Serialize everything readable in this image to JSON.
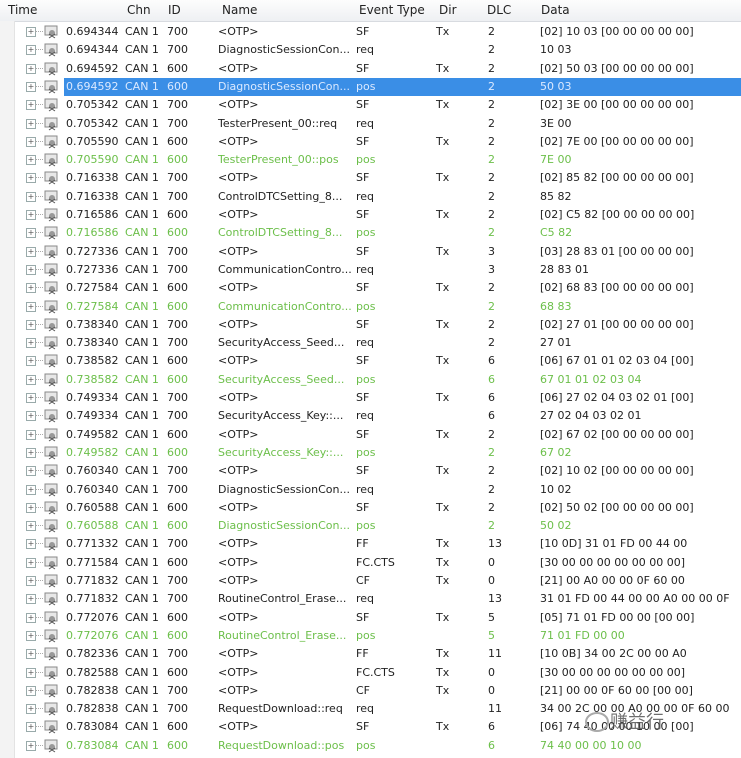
{
  "columns": {
    "time": "Time",
    "chn": "Chn",
    "id": "ID",
    "name": "Name",
    "event_type": "Event Type",
    "dir": "Dir",
    "dlc": "DLC",
    "data": "Data"
  },
  "selected_row": 3,
  "colors": {
    "selection": "#3a8ee6",
    "response_text": "#6cbf4a"
  },
  "watermark": "赚益行",
  "rows": [
    {
      "time": "0.694344",
      "chn": "CAN 1",
      "id": "700",
      "name": "<OTP>",
      "ev": "SF",
      "dir": "Tx",
      "dlc": "2",
      "data": "[02] 10 03 [00 00 00 00 00]",
      "style": "normal"
    },
    {
      "time": "0.694344",
      "chn": "CAN 1",
      "id": "700",
      "name": "DiagnosticSessionCon...",
      "ev": "req",
      "dir": "",
      "dlc": "2",
      "data": "10 03",
      "style": "normal"
    },
    {
      "time": "0.694592",
      "chn": "CAN 1",
      "id": "600",
      "name": "<OTP>",
      "ev": "SF",
      "dir": "Tx",
      "dlc": "2",
      "data": "[02] 50 03 [00 00 00 00 00]",
      "style": "normal"
    },
    {
      "time": "0.694592",
      "chn": "CAN 1",
      "id": "600",
      "name": "DiagnosticSessionCon...",
      "ev": "pos",
      "dir": "",
      "dlc": "2",
      "data": "50 03",
      "style": "selected"
    },
    {
      "time": "0.705342",
      "chn": "CAN 1",
      "id": "700",
      "name": "<OTP>",
      "ev": "SF",
      "dir": "Tx",
      "dlc": "2",
      "data": "[02] 3E 00 [00 00 00 00 00]",
      "style": "normal"
    },
    {
      "time": "0.705342",
      "chn": "CAN 1",
      "id": "700",
      "name": "TesterPresent_00::req",
      "ev": "req",
      "dir": "",
      "dlc": "2",
      "data": "3E 00",
      "style": "normal"
    },
    {
      "time": "0.705590",
      "chn": "CAN 1",
      "id": "600",
      "name": "<OTP>",
      "ev": "SF",
      "dir": "Tx",
      "dlc": "2",
      "data": "[02] 7E 00 [00 00 00 00 00]",
      "style": "normal"
    },
    {
      "time": "0.705590",
      "chn": "CAN 1",
      "id": "600",
      "name": "TesterPresent_00::pos",
      "ev": "pos",
      "dir": "",
      "dlc": "2",
      "data": "7E 00",
      "style": "green"
    },
    {
      "time": "0.716338",
      "chn": "CAN 1",
      "id": "700",
      "name": "<OTP>",
      "ev": "SF",
      "dir": "Tx",
      "dlc": "2",
      "data": "[02] 85 82 [00 00 00 00 00]",
      "style": "normal"
    },
    {
      "time": "0.716338",
      "chn": "CAN 1",
      "id": "700",
      "name": "ControlDTCSetting_8...",
      "ev": "req",
      "dir": "",
      "dlc": "2",
      "data": "85 82",
      "style": "normal"
    },
    {
      "time": "0.716586",
      "chn": "CAN 1",
      "id": "600",
      "name": "<OTP>",
      "ev": "SF",
      "dir": "Tx",
      "dlc": "2",
      "data": "[02] C5 82 [00 00 00 00 00]",
      "style": "normal"
    },
    {
      "time": "0.716586",
      "chn": "CAN 1",
      "id": "600",
      "name": "ControlDTCSetting_8...",
      "ev": "pos",
      "dir": "",
      "dlc": "2",
      "data": "C5 82",
      "style": "green"
    },
    {
      "time": "0.727336",
      "chn": "CAN 1",
      "id": "700",
      "name": "<OTP>",
      "ev": "SF",
      "dir": "Tx",
      "dlc": "3",
      "data": "[03] 28 83 01 [00 00 00 00]",
      "style": "normal"
    },
    {
      "time": "0.727336",
      "chn": "CAN 1",
      "id": "700",
      "name": "CommunicationContro...",
      "ev": "req",
      "dir": "",
      "dlc": "3",
      "data": "28 83 01",
      "style": "normal"
    },
    {
      "time": "0.727584",
      "chn": "CAN 1",
      "id": "600",
      "name": "<OTP>",
      "ev": "SF",
      "dir": "Tx",
      "dlc": "2",
      "data": "[02] 68 83 [00 00 00 00 00]",
      "style": "normal"
    },
    {
      "time": "0.727584",
      "chn": "CAN 1",
      "id": "600",
      "name": "CommunicationContro...",
      "ev": "pos",
      "dir": "",
      "dlc": "2",
      "data": "68 83",
      "style": "green"
    },
    {
      "time": "0.738340",
      "chn": "CAN 1",
      "id": "700",
      "name": "<OTP>",
      "ev": "SF",
      "dir": "Tx",
      "dlc": "2",
      "data": "[02] 27 01 [00 00 00 00 00]",
      "style": "normal"
    },
    {
      "time": "0.738340",
      "chn": "CAN 1",
      "id": "700",
      "name": "SecurityAccess_Seed...",
      "ev": "req",
      "dir": "",
      "dlc": "2",
      "data": "27 01",
      "style": "normal"
    },
    {
      "time": "0.738582",
      "chn": "CAN 1",
      "id": "600",
      "name": "<OTP>",
      "ev": "SF",
      "dir": "Tx",
      "dlc": "6",
      "data": "[06] 67 01 01 02 03 04 [00]",
      "style": "normal"
    },
    {
      "time": "0.738582",
      "chn": "CAN 1",
      "id": "600",
      "name": "SecurityAccess_Seed...",
      "ev": "pos",
      "dir": "",
      "dlc": "6",
      "data": "67 01 01 02 03 04",
      "style": "green"
    },
    {
      "time": "0.749334",
      "chn": "CAN 1",
      "id": "700",
      "name": "<OTP>",
      "ev": "SF",
      "dir": "Tx",
      "dlc": "6",
      "data": "[06] 27 02 04 03 02 01 [00]",
      "style": "normal"
    },
    {
      "time": "0.749334",
      "chn": "CAN 1",
      "id": "700",
      "name": "SecurityAccess_Key::...",
      "ev": "req",
      "dir": "",
      "dlc": "6",
      "data": "27 02 04 03 02 01",
      "style": "normal"
    },
    {
      "time": "0.749582",
      "chn": "CAN 1",
      "id": "600",
      "name": "<OTP>",
      "ev": "SF",
      "dir": "Tx",
      "dlc": "2",
      "data": "[02] 67 02 [00 00 00 00 00]",
      "style": "normal"
    },
    {
      "time": "0.749582",
      "chn": "CAN 1",
      "id": "600",
      "name": "SecurityAccess_Key::...",
      "ev": "pos",
      "dir": "",
      "dlc": "2",
      "data": "67 02",
      "style": "green"
    },
    {
      "time": "0.760340",
      "chn": "CAN 1",
      "id": "700",
      "name": "<OTP>",
      "ev": "SF",
      "dir": "Tx",
      "dlc": "2",
      "data": "[02] 10 02 [00 00 00 00 00]",
      "style": "normal"
    },
    {
      "time": "0.760340",
      "chn": "CAN 1",
      "id": "700",
      "name": "DiagnosticSessionCon...",
      "ev": "req",
      "dir": "",
      "dlc": "2",
      "data": "10 02",
      "style": "normal"
    },
    {
      "time": "0.760588",
      "chn": "CAN 1",
      "id": "600",
      "name": "<OTP>",
      "ev": "SF",
      "dir": "Tx",
      "dlc": "2",
      "data": "[02] 50 02 [00 00 00 00 00]",
      "style": "normal"
    },
    {
      "time": "0.760588",
      "chn": "CAN 1",
      "id": "600",
      "name": "DiagnosticSessionCon...",
      "ev": "pos",
      "dir": "",
      "dlc": "2",
      "data": "50 02",
      "style": "green"
    },
    {
      "time": "0.771332",
      "chn": "CAN 1",
      "id": "700",
      "name": "<OTP>",
      "ev": "FF",
      "dir": "Tx",
      "dlc": "13",
      "data": "[10 0D] 31 01 FD 00 44 00",
      "style": "normal"
    },
    {
      "time": "0.771584",
      "chn": "CAN 1",
      "id": "600",
      "name": "<OTP>",
      "ev": "FC.CTS",
      "dir": "Tx",
      "dlc": "0",
      "data": "[30 00 00 00 00 00 00 00]",
      "style": "normal"
    },
    {
      "time": "0.771832",
      "chn": "CAN 1",
      "id": "700",
      "name": "<OTP>",
      "ev": "CF",
      "dir": "Tx",
      "dlc": "0",
      "data": "[21] 00 A0 00 00 0F 60 00",
      "style": "normal"
    },
    {
      "time": "0.771832",
      "chn": "CAN 1",
      "id": "700",
      "name": "RoutineControl_Erase...",
      "ev": "req",
      "dir": "",
      "dlc": "13",
      "data": "31 01 FD 00 44 00 00 A0 00 00 0F",
      "style": "normal"
    },
    {
      "time": "0.772076",
      "chn": "CAN 1",
      "id": "600",
      "name": "<OTP>",
      "ev": "SF",
      "dir": "Tx",
      "dlc": "5",
      "data": "[05] 71 01 FD 00 00 [00 00]",
      "style": "normal"
    },
    {
      "time": "0.772076",
      "chn": "CAN 1",
      "id": "600",
      "name": "RoutineControl_Erase...",
      "ev": "pos",
      "dir": "",
      "dlc": "5",
      "data": "71 01 FD 00 00",
      "style": "green"
    },
    {
      "time": "0.782336",
      "chn": "CAN 1",
      "id": "700",
      "name": "<OTP>",
      "ev": "FF",
      "dir": "Tx",
      "dlc": "11",
      "data": "[10 0B] 34 00 2C 00 00 A0",
      "style": "normal"
    },
    {
      "time": "0.782588",
      "chn": "CAN 1",
      "id": "600",
      "name": "<OTP>",
      "ev": "FC.CTS",
      "dir": "Tx",
      "dlc": "0",
      "data": "[30 00 00 00 00 00 00 00]",
      "style": "normal"
    },
    {
      "time": "0.782838",
      "chn": "CAN 1",
      "id": "700",
      "name": "<OTP>",
      "ev": "CF",
      "dir": "Tx",
      "dlc": "0",
      "data": "[21] 00 00 0F 60 00 [00 00]",
      "style": "normal"
    },
    {
      "time": "0.782838",
      "chn": "CAN 1",
      "id": "700",
      "name": "RequestDownload::req",
      "ev": "req",
      "dir": "",
      "dlc": "11",
      "data": "34 00 2C 00 00 A0 00 00 0F 60 00",
      "style": "normal"
    },
    {
      "time": "0.783084",
      "chn": "CAN 1",
      "id": "600",
      "name": "<OTP>",
      "ev": "SF",
      "dir": "Tx",
      "dlc": "6",
      "data": "[06] 74 40 00 00 10 00 [00]",
      "style": "normal"
    },
    {
      "time": "0.783084",
      "chn": "CAN 1",
      "id": "600",
      "name": "RequestDownload::pos",
      "ev": "pos",
      "dir": "",
      "dlc": "6",
      "data": "74 40 00 00 10 00",
      "style": "green"
    }
  ]
}
